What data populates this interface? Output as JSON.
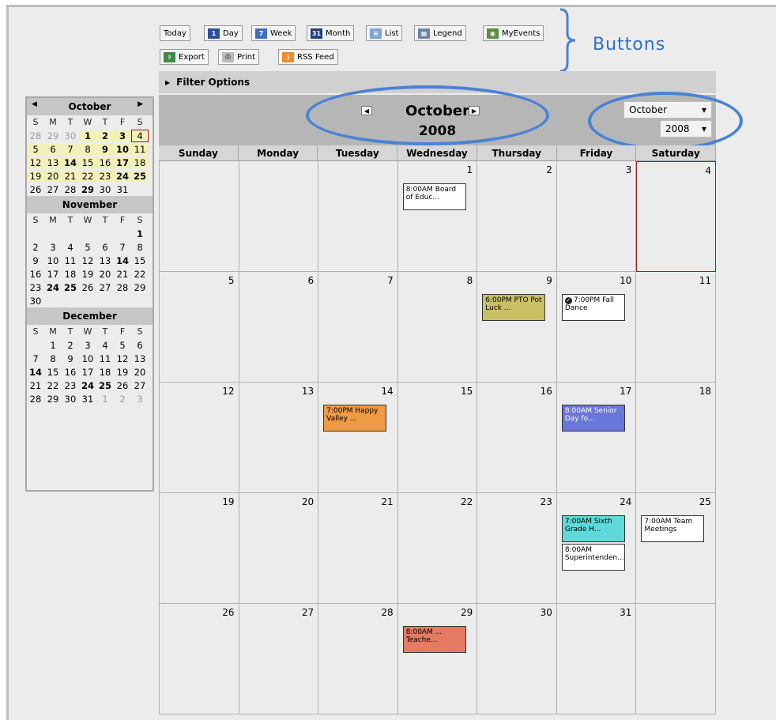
{
  "toolbar": {
    "today": "Today",
    "day": "Day",
    "week": "Week",
    "month": "Month",
    "list": "List",
    "legend": "Legend",
    "myevents": "MyEvents",
    "export": "Export",
    "print": "Print",
    "rss": "RSS Feed"
  },
  "annotation": {
    "label": "Buttons",
    "color": "#4a82d4"
  },
  "filter": {
    "label": "Filter Options"
  },
  "header": {
    "month": "October",
    "year": "2008",
    "month_select": "October",
    "year_select": "2008"
  },
  "dow_short": [
    "S",
    "M",
    "T",
    "W",
    "T",
    "F",
    "S"
  ],
  "dow_long": [
    "Sunday",
    "Monday",
    "Tuesday",
    "Wednesday",
    "Thursday",
    "Friday",
    "Saturday"
  ],
  "mini": [
    {
      "title": "October",
      "weeks": [
        [
          "28",
          "29",
          "30",
          "1",
          "2",
          "3",
          "4"
        ],
        [
          "5",
          "6",
          "7",
          "8",
          "9",
          "10",
          "11"
        ],
        [
          "12",
          "13",
          "14",
          "15",
          "16",
          "17",
          "18"
        ],
        [
          "19",
          "20",
          "21",
          "22",
          "23",
          "24",
          "25"
        ],
        [
          "26",
          "27",
          "28",
          "29",
          "30",
          "31"
        ]
      ]
    },
    {
      "title": "November",
      "weeks": [
        [
          "",
          "",
          "",
          "",
          "",
          "",
          "1"
        ],
        [
          "2",
          "3",
          "4",
          "5",
          "6",
          "7",
          "8"
        ],
        [
          "9",
          "10",
          "11",
          "12",
          "13",
          "14",
          "15"
        ],
        [
          "16",
          "17",
          "18",
          "19",
          "20",
          "21",
          "22"
        ],
        [
          "23",
          "24",
          "25",
          "26",
          "27",
          "28",
          "29"
        ],
        [
          "30"
        ]
      ]
    },
    {
      "title": "December",
      "weeks": [
        [
          "",
          "1",
          "2",
          "3",
          "4",
          "5",
          "6"
        ],
        [
          "7",
          "8",
          "9",
          "10",
          "11",
          "12",
          "13"
        ],
        [
          "14",
          "15",
          "16",
          "17",
          "18",
          "19",
          "20"
        ],
        [
          "21",
          "22",
          "23",
          "24",
          "25",
          "26",
          "27"
        ],
        [
          "28",
          "29",
          "30",
          "31",
          "1",
          "2",
          "3"
        ]
      ]
    }
  ],
  "grid": [
    [
      {
        "d": ""
      },
      {
        "d": ""
      },
      {
        "d": ""
      },
      {
        "d": "1",
        "events": [
          {
            "t": "8:00AM Board of Educ..."
          }
        ]
      },
      {
        "d": "2"
      },
      {
        "d": "3"
      },
      {
        "d": "4",
        "today": true
      }
    ],
    [
      {
        "d": "5"
      },
      {
        "d": "6"
      },
      {
        "d": "7"
      },
      {
        "d": "8"
      },
      {
        "d": "9",
        "events": [
          {
            "t": "6:00PM PTO Pot Luck ...",
            "c": "yellow"
          }
        ]
      },
      {
        "d": "10",
        "events": [
          {
            "t": "7:00PM Fall Dance",
            "check": true
          }
        ]
      },
      {
        "d": "11"
      }
    ],
    [
      {
        "d": "12"
      },
      {
        "d": "13"
      },
      {
        "d": "14",
        "events": [
          {
            "t": "7:00PM Happy Valley ...",
            "c": "orange"
          }
        ]
      },
      {
        "d": "15"
      },
      {
        "d": "16"
      },
      {
        "d": "17",
        "events": [
          {
            "t": "8:00AM Senior Day fo...",
            "c": "blue"
          }
        ]
      },
      {
        "d": "18"
      }
    ],
    [
      {
        "d": "19"
      },
      {
        "d": "20"
      },
      {
        "d": "21"
      },
      {
        "d": "22"
      },
      {
        "d": "23"
      },
      {
        "d": "24",
        "events": [
          {
            "t": "7:00AM Sixth Grade H...",
            "c": "cyan"
          },
          {
            "t": "8:00AM Superintenden..."
          }
        ]
      },
      {
        "d": "25",
        "events": [
          {
            "t": "7:00AM Team Meetings"
          }
        ]
      }
    ],
    [
      {
        "d": "26"
      },
      {
        "d": "27"
      },
      {
        "d": "28"
      },
      {
        "d": "29",
        "events": [
          {
            "t": "8:00AM ... Teache...",
            "c": "red"
          }
        ]
      },
      {
        "d": "30"
      },
      {
        "d": "31"
      },
      {
        "d": ""
      }
    ]
  ]
}
